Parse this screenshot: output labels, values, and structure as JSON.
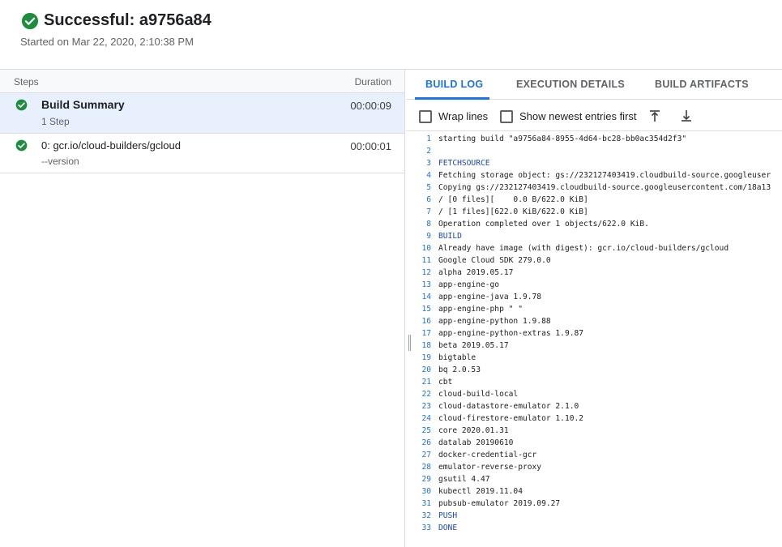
{
  "header": {
    "title": "Successful: a9756a84",
    "started": "Started on Mar 22, 2020, 2:10:38 PM",
    "status_color": "#1e8e3e"
  },
  "steps": {
    "col_steps": "Steps",
    "col_duration": "Duration",
    "items": [
      {
        "name": "Build Summary",
        "sub": "1 Step",
        "duration": "00:00:09",
        "selected": true
      },
      {
        "name": "0: gcr.io/cloud-builders/gcloud",
        "sub": "--version",
        "duration": "00:00:01",
        "selected": false
      }
    ]
  },
  "tabs": [
    {
      "label": "BUILD LOG",
      "active": true
    },
    {
      "label": "EXECUTION DETAILS",
      "active": false
    },
    {
      "label": "BUILD ARTIFACTS",
      "active": false
    }
  ],
  "toolbar": {
    "wrap_label": "Wrap lines",
    "newest_label": "Show newest entries first",
    "top_icon": "scroll-to-top-icon",
    "bottom_icon": "scroll-to-bottom-icon"
  },
  "log": [
    {
      "n": "1",
      "t": "starting build \"a9756a84-8955-4d64-bc28-bb0ac354d2f3\""
    },
    {
      "n": "2",
      "t": ""
    },
    {
      "n": "3",
      "t": "FETCHSOURCE",
      "kw": true
    },
    {
      "n": "4",
      "t": "Fetching storage object: gs://232127403419.cloudbuild-source.googleuser"
    },
    {
      "n": "5",
      "t": "Copying gs://232127403419.cloudbuild-source.googleusercontent.com/18a13"
    },
    {
      "n": "6",
      "t": "/ [0 files][    0.0 B/622.0 KiB]"
    },
    {
      "n": "7",
      "t": "/ [1 files][622.0 KiB/622.0 KiB]"
    },
    {
      "n": "8",
      "t": "Operation completed over 1 objects/622.0 KiB."
    },
    {
      "n": "9",
      "t": "BUILD",
      "kw": true
    },
    {
      "n": "10",
      "t": "Already have image (with digest): gcr.io/cloud-builders/gcloud"
    },
    {
      "n": "11",
      "t": "Google Cloud SDK 279.0.0"
    },
    {
      "n": "12",
      "t": "alpha 2019.05.17"
    },
    {
      "n": "13",
      "t": "app-engine-go"
    },
    {
      "n": "14",
      "t": "app-engine-java 1.9.78"
    },
    {
      "n": "15",
      "t": "app-engine-php \" \""
    },
    {
      "n": "16",
      "t": "app-engine-python 1.9.88"
    },
    {
      "n": "17",
      "t": "app-engine-python-extras 1.9.87"
    },
    {
      "n": "18",
      "t": "beta 2019.05.17"
    },
    {
      "n": "19",
      "t": "bigtable"
    },
    {
      "n": "20",
      "t": "bq 2.0.53"
    },
    {
      "n": "21",
      "t": "cbt"
    },
    {
      "n": "22",
      "t": "cloud-build-local"
    },
    {
      "n": "23",
      "t": "cloud-datastore-emulator 2.1.0"
    },
    {
      "n": "24",
      "t": "cloud-firestore-emulator 1.10.2"
    },
    {
      "n": "25",
      "t": "core 2020.01.31"
    },
    {
      "n": "26",
      "t": "datalab 20190610"
    },
    {
      "n": "27",
      "t": "docker-credential-gcr"
    },
    {
      "n": "28",
      "t": "emulator-reverse-proxy"
    },
    {
      "n": "29",
      "t": "gsutil 4.47"
    },
    {
      "n": "30",
      "t": "kubectl 2019.11.04"
    },
    {
      "n": "31",
      "t": "pubsub-emulator 2019.09.27"
    },
    {
      "n": "32",
      "t": "PUSH",
      "kw": true
    },
    {
      "n": "33",
      "t": "DONE",
      "kw": true
    }
  ]
}
